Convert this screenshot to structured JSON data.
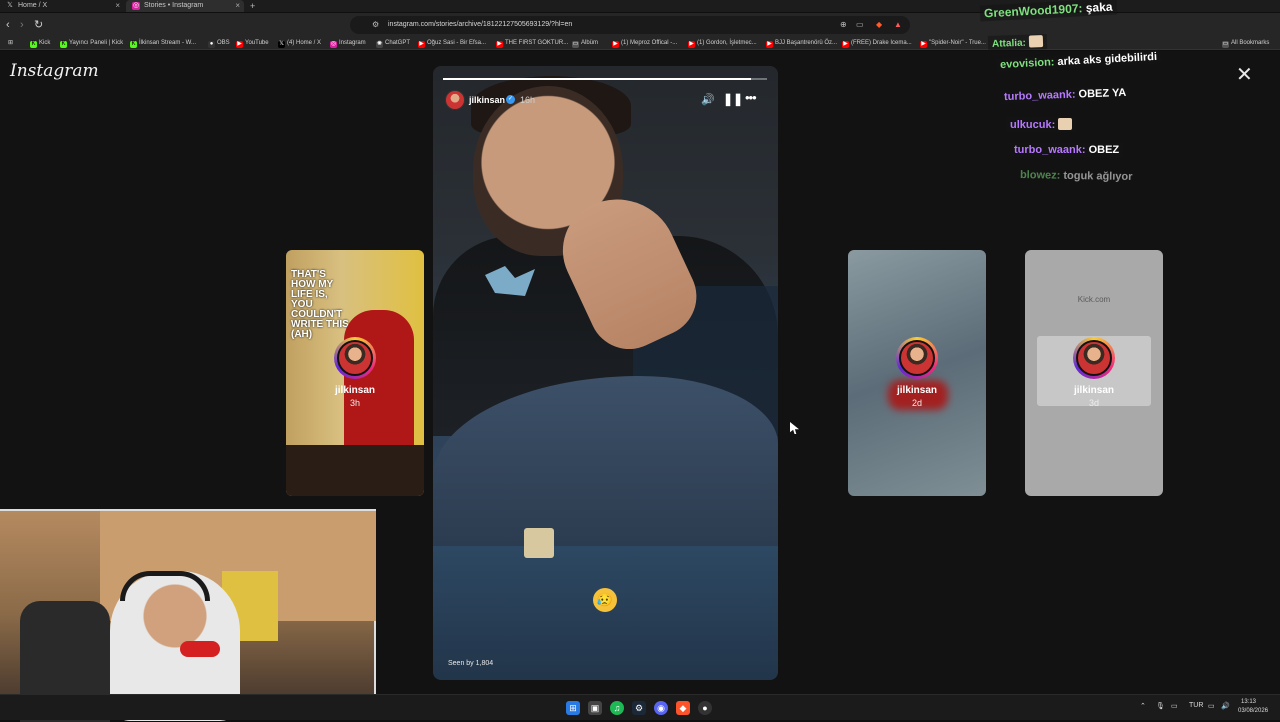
{
  "browser": {
    "tabs": [
      {
        "title": "Home / X",
        "icon": "x-logo-icon"
      },
      {
        "title": "Stories • Instagram",
        "icon": "instagram-icon"
      }
    ],
    "url": "instagram.com/stories/archive/18122127505693129/?hl=en",
    "bookmarks": [
      "Kick",
      "Yayıncı Paneli | Kick",
      "İlkinsan Stream - W...",
      "OBS",
      "YouTube",
      "(4) Home / X",
      "Instagram",
      "ChatGPT",
      "Oğuz Sasi - Bir Efsa...",
      "THE FIRST GOKTUR...",
      "Albüm",
      "(1) Meproz Offical -...",
      "(1) Gordon, İşletmec...",
      "BJJ Başantrenörü Öz...",
      "(FREE) Drake Icema...",
      "\"Spider-Noir\" - True...",
      "All Bookmarks"
    ]
  },
  "instagram": {
    "logo": "Instagram",
    "main_story": {
      "username": "jilkinsan",
      "time": "16h",
      "seen_by": "Seen by 1,804",
      "progress": 0.95,
      "emoji": "😥"
    },
    "side_stories": [
      {
        "username": "jilkinsan",
        "time": "3h",
        "poster_text": "THAT'S HOW MY LIFE IS, YOU COULDN'T WRITE THIS (AH)"
      },
      {
        "username": "jilkinsan",
        "time": "2d"
      },
      {
        "username": "jilkinsan",
        "time": "3d",
        "link_text": "Kick.com"
      }
    ]
  },
  "chat": [
    {
      "user": "GreenWood1907:",
      "msg": "şaka"
    },
    {
      "user": "Attalia:",
      "msg": ""
    },
    {
      "user": "evovision:",
      "msg": "arka aks gidebilirdi"
    },
    {
      "user": "turbo_waank:",
      "msg": "OBEZ YA"
    },
    {
      "user": "ulkucuk:",
      "msg": ""
    },
    {
      "user": "turbo_waank:",
      "msg": "OBEZ"
    },
    {
      "user": "blowez:",
      "msg": "toguk ağlıyor"
    }
  ],
  "taskbar": {
    "lang": "TUR",
    "time": "13:13",
    "date": "03/08/2026"
  }
}
